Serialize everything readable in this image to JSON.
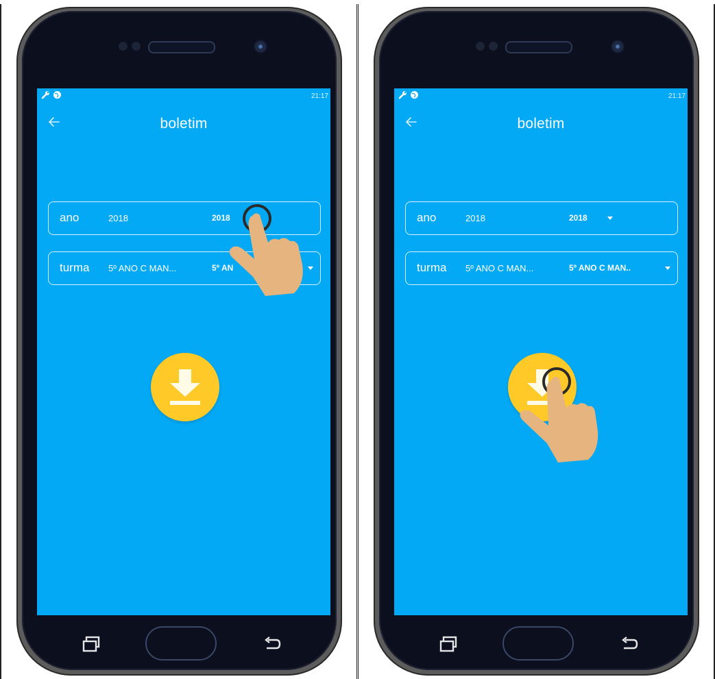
{
  "panels": [
    {
      "status": {
        "time": "21:17"
      },
      "appbar": {
        "title": "boletim"
      },
      "form": {
        "ano": {
          "label": "ano",
          "value": "2018",
          "dropdown_value": "2018"
        },
        "turma": {
          "label": "turma",
          "value": "5º ANO C MAN...",
          "dropdown_value": "5º AN"
        }
      },
      "icons": {
        "back": "arrow-left-icon",
        "download": "download-icon",
        "recents": "recents-icon",
        "nav_back": "back-icon",
        "status_wrench": "wrench-icon",
        "status_globe": "globe-icon",
        "tap_hand": "hand-pointer-icon"
      }
    },
    {
      "status": {
        "time": "21:17"
      },
      "appbar": {
        "title": "boletim"
      },
      "form": {
        "ano": {
          "label": "ano",
          "value": "2018",
          "dropdown_value": "2018"
        },
        "turma": {
          "label": "turma",
          "value": "5º ANO C MAN...",
          "dropdown_value": "5º ANO C MAN.."
        }
      }
    }
  ],
  "colors": {
    "screen_bg": "#03a9f4",
    "download_button": "#ffc928",
    "hand": "#e6b57f",
    "bezel": "#0b0f1e"
  }
}
